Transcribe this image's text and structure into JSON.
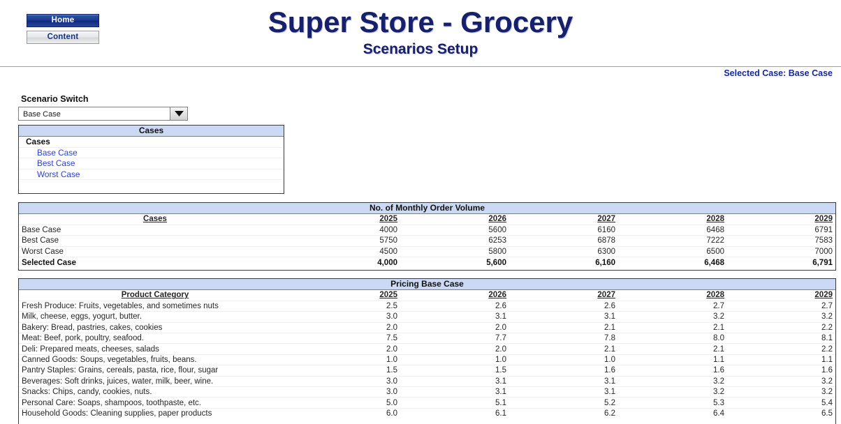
{
  "header": {
    "nav": [
      {
        "name": "home",
        "label": "Home"
      },
      {
        "name": "content",
        "label": "Content"
      }
    ],
    "title": "Super Store - Grocery",
    "subtitle": "Scenarios Setup",
    "selected_case_text": "Selected Case: Base Case",
    "accent_color": "#16206b",
    "link_color": "#2b3fd6",
    "table_header_color": "#ccd9f4"
  },
  "scenario_switch": {
    "label": "Scenario Switch",
    "value": "Base Case",
    "placeholder": "Base Case",
    "arrow_icon": "chevron-down-icon",
    "options": [
      "Base Case",
      "Best Case",
      "Worst Case"
    ]
  },
  "cases_box": {
    "title": "Cases",
    "group_label": "Cases",
    "items": [
      "Base Case",
      "Best Case",
      "Worst Case"
    ]
  },
  "volume_table": {
    "title": "No. of Monthly Order Volume",
    "row_header": "Cases",
    "columns": [
      "2025",
      "2026",
      "2027",
      "2028",
      "2029"
    ],
    "rows": [
      {
        "label": "Base Case",
        "style": "plain",
        "values": [
          "4000",
          "5600",
          "6160",
          "6468",
          "6791"
        ]
      },
      {
        "label": "Best Case",
        "style": "blue",
        "values": [
          "5750",
          "6253",
          "6878",
          "7222",
          "7583"
        ]
      },
      {
        "label": "Worst Case",
        "style": "blue",
        "values": [
          "4500",
          "5800",
          "6300",
          "6500",
          "7000"
        ]
      },
      {
        "label": "Selected Case",
        "style": "bold",
        "values": [
          "4,000",
          "5,600",
          "6,160",
          "6,468",
          "6,791"
        ]
      }
    ]
  },
  "pricing_table": {
    "title": "Pricing Base Case",
    "row_header": "Product Category",
    "columns": [
      "2025",
      "2026",
      "2027",
      "2028",
      "2029"
    ],
    "rows": [
      {
        "label": "Fresh Produce: Fruits, vegetables, and sometimes nuts",
        "values": [
          "2.5",
          "2.6",
          "2.6",
          "2.7",
          "2.7"
        ]
      },
      {
        "label": "Milk, cheese, eggs, yogurt, butter.",
        "values": [
          "3.0",
          "3.1",
          "3.1",
          "3.2",
          "3.2"
        ]
      },
      {
        "label": "Bakery: Bread, pastries, cakes, cookies",
        "values": [
          "2.0",
          "2.0",
          "2.1",
          "2.1",
          "2.2"
        ]
      },
      {
        "label": "Meat: Beef, pork, poultry, seafood.",
        "values": [
          "7.5",
          "7.7",
          "7.8",
          "8.0",
          "8.1"
        ]
      },
      {
        "label": "Deli: Prepared meats, cheeses, salads",
        "values": [
          "2.0",
          "2.0",
          "2.1",
          "2.1",
          "2.2"
        ]
      },
      {
        "label": "Canned Goods: Soups, vegetables, fruits, beans.",
        "values": [
          "1.0",
          "1.0",
          "1.0",
          "1.1",
          "1.1"
        ]
      },
      {
        "label": "Pantry Staples: Grains, cereals, pasta, rice, flour, sugar",
        "values": [
          "1.5",
          "1.5",
          "1.6",
          "1.6",
          "1.6"
        ]
      },
      {
        "label": "Beverages: Soft drinks, juices, water, milk, beer, wine.",
        "values": [
          "3.0",
          "3.1",
          "3.1",
          "3.2",
          "3.2"
        ]
      },
      {
        "label": "Snacks: Chips, candy, cookies, nuts.",
        "values": [
          "3.0",
          "3.1",
          "3.1",
          "3.2",
          "3.2"
        ]
      },
      {
        "label": "Personal Care: Soaps, shampoos, toothpaste, etc.",
        "values": [
          "5.0",
          "5.1",
          "5.2",
          "5.3",
          "5.4"
        ]
      },
      {
        "label": "Household Goods: Cleaning supplies, paper products",
        "values": [
          "6.0",
          "6.1",
          "6.2",
          "6.4",
          "6.5"
        ]
      }
    ]
  }
}
